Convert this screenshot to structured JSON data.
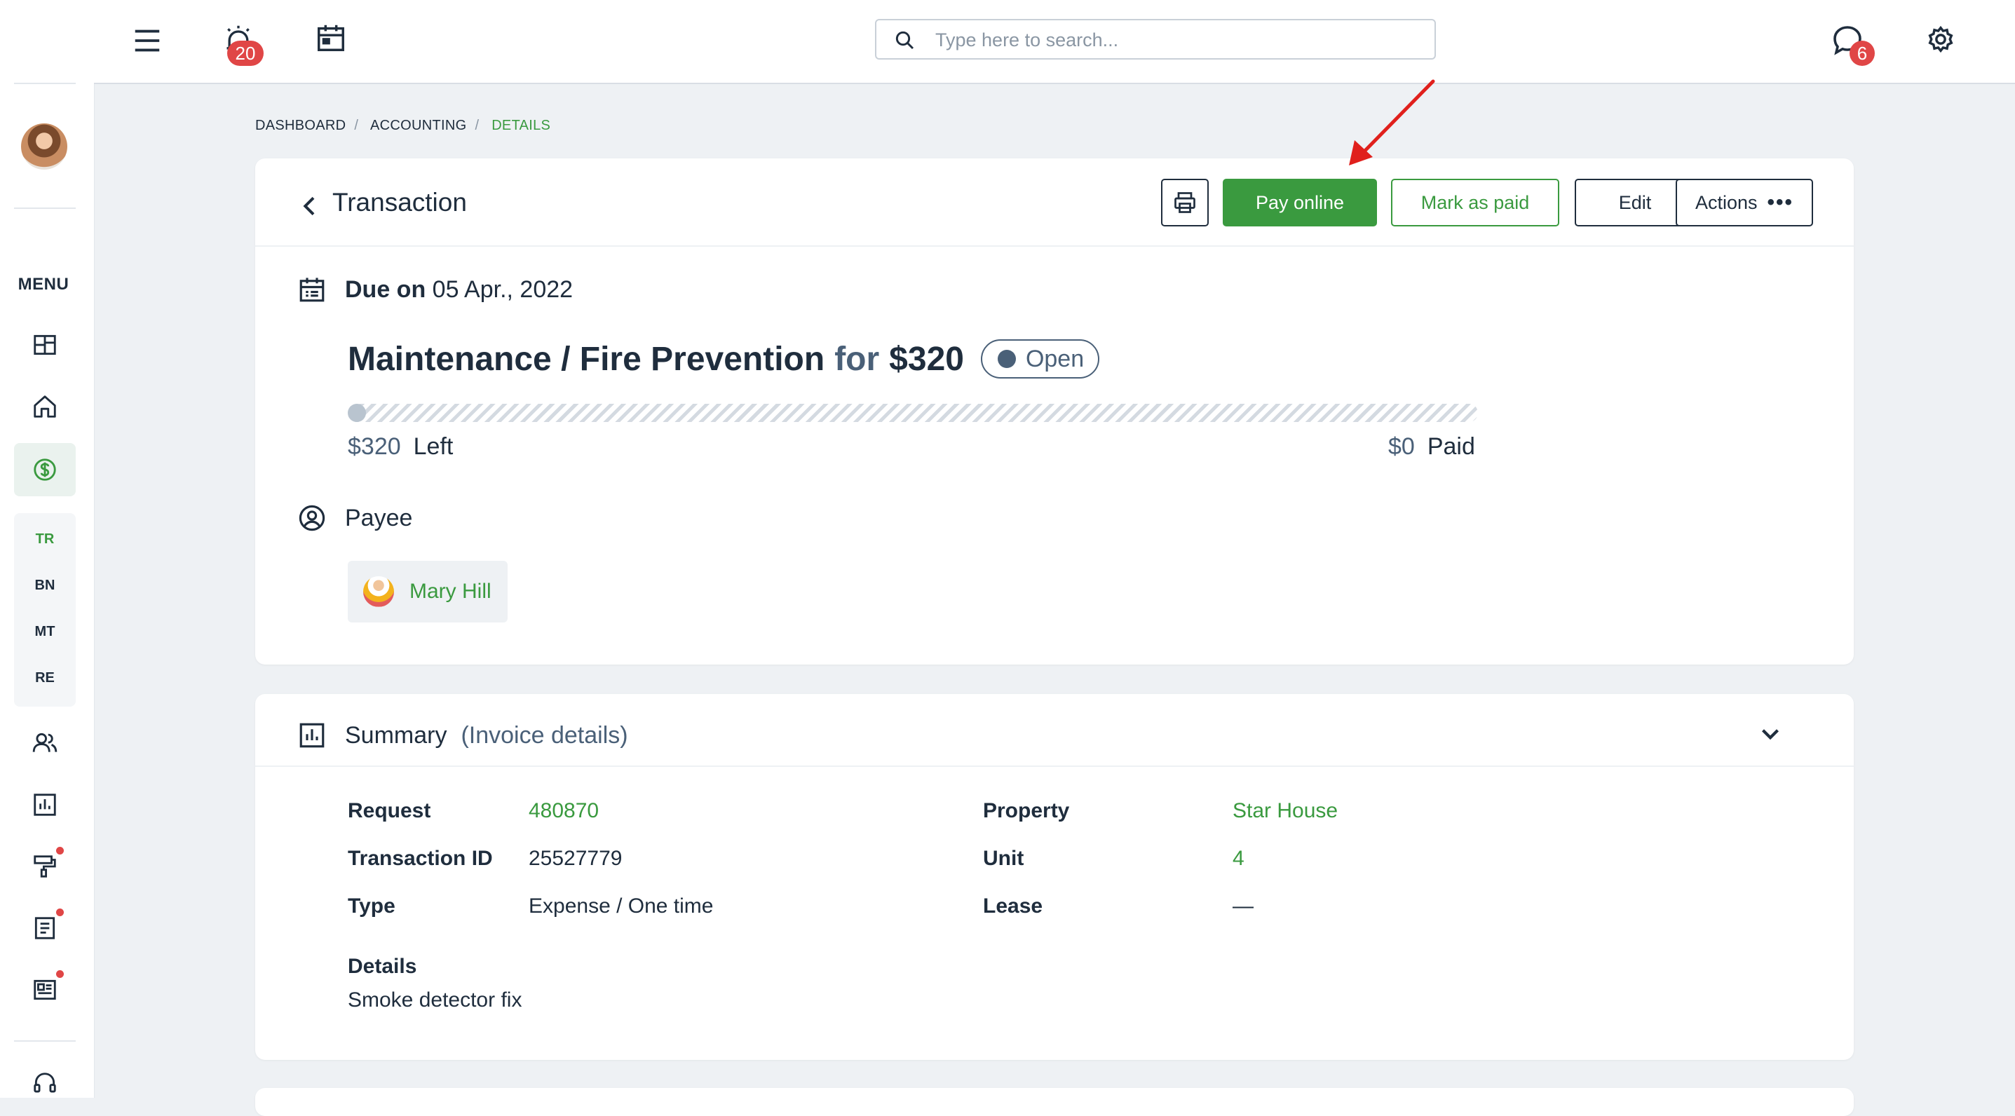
{
  "sidebar": {
    "menu_label": "MENU",
    "sub_items": [
      "TR",
      "BN",
      "MT",
      "RE"
    ]
  },
  "topbar": {
    "notifications_count": "20",
    "messages_count": "6",
    "search_placeholder": "Type here to search..."
  },
  "breadcrumb": [
    "DASHBOARD",
    "ACCOUNTING",
    "DETAILS"
  ],
  "transaction": {
    "title": "Transaction",
    "buttons": {
      "pay_online": "Pay online",
      "mark_as_paid": "Mark as paid",
      "edit": "Edit",
      "actions": "Actions"
    },
    "due_label": "Due on",
    "due_date": "05 Apr., 2022",
    "category": "Maintenance / Fire Prevention",
    "for_word": "for",
    "amount": "$320",
    "status": "Open",
    "progress_paid_fraction": 0,
    "left_amount": "$320",
    "left_label": "Left",
    "paid_amount": "$0",
    "paid_label": "Paid",
    "payee_label": "Payee",
    "payee_name": "Mary Hill"
  },
  "summary": {
    "title": "Summary",
    "subtitle": "(Invoice details)",
    "fields": {
      "request_label": "Request",
      "request_value": "480870",
      "transaction_id_label": "Transaction ID",
      "transaction_id_value": "25527779",
      "type_label": "Type",
      "type_value": "Expense / One time",
      "property_label": "Property",
      "property_value": "Star House",
      "unit_label": "Unit",
      "unit_value": "4",
      "lease_label": "Lease",
      "lease_value": "—"
    },
    "details_label": "Details",
    "details_value": "Smoke detector fix"
  },
  "colors": {
    "brand_green": "#3a9a3f",
    "badge_red": "#e04646",
    "status_slate": "#4a6078",
    "annotation_arrow": "#e0201c"
  },
  "icons": {
    "topbar": [
      "hamburger-menu-icon",
      "alarm-icon",
      "calendar-icon",
      "search-icon",
      "chat-icon",
      "gear-icon"
    ],
    "sidebar": [
      "dashboard-icon",
      "home-icon",
      "dollar-icon",
      "people-icon",
      "chart-icon",
      "paint-roller-icon",
      "document-icon",
      "newspaper-icon",
      "headset-icon"
    ]
  }
}
